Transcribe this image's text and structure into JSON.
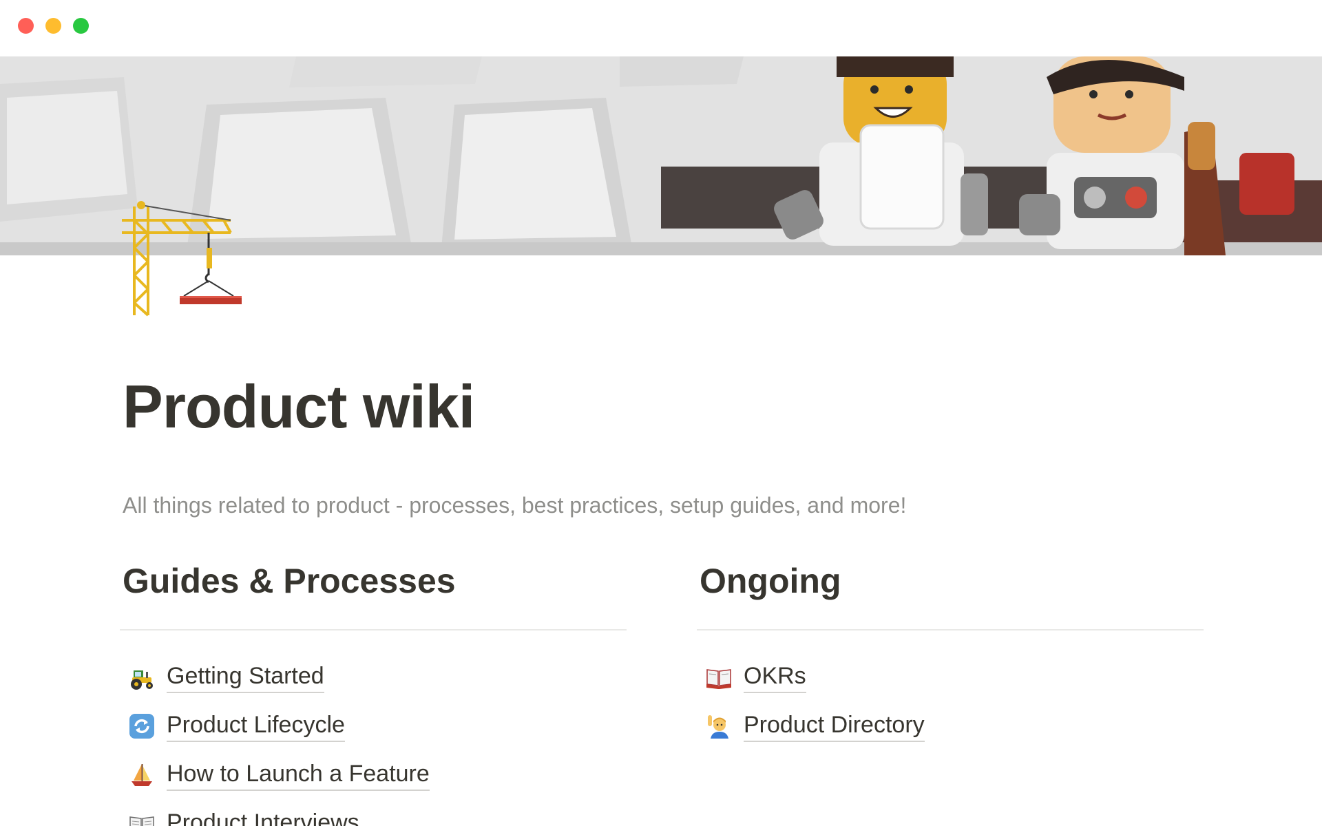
{
  "window": {
    "controls": [
      "close",
      "minimize",
      "maximize"
    ]
  },
  "cover": {
    "description_icon": "keyboard-lego-cover-image"
  },
  "page": {
    "icon": "construction-crane-icon",
    "title": "Product wiki",
    "description": "All things related to product - processes, best practices, setup guides, and more!"
  },
  "columns": {
    "left": {
      "heading": "Guides & Processes",
      "links": [
        {
          "icon": "tractor-icon",
          "label": "Getting Started"
        },
        {
          "icon": "cycle-arrows-icon",
          "label": "Product Lifecycle"
        },
        {
          "icon": "sailboat-icon",
          "label": "How to Launch a Feature"
        },
        {
          "icon": "open-book-icon",
          "label": "Product Interviews"
        }
      ]
    },
    "right": {
      "heading": "Ongoing",
      "links": [
        {
          "icon": "red-book-icon",
          "label": "OKRs"
        },
        {
          "icon": "person-raising-hand-icon",
          "label": "Product Directory"
        }
      ]
    }
  },
  "colors": {
    "text": "#37352f",
    "muted": "#8e8e8b",
    "divider": "#e9e9e7",
    "close": "#ff5f57",
    "minimize": "#febc2e",
    "maximize": "#28c840"
  }
}
